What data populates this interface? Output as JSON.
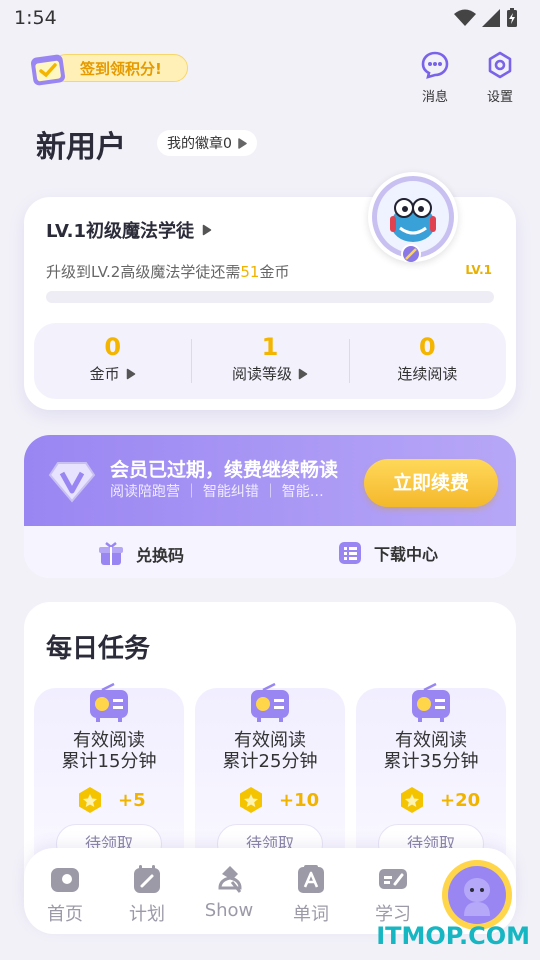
{
  "status": {
    "time": "1:54"
  },
  "header": {
    "checkin_label": "签到领积分!",
    "messages_label": "消息",
    "settings_label": "设置"
  },
  "profile": {
    "title": "新用户",
    "badge_label": "我的徽章0"
  },
  "level": {
    "title": "LV.1初级魔法学徒",
    "upgrade_prefix": "升级到LV.2高级魔法学徒还需",
    "upgrade_amount": "51",
    "upgrade_suffix": "金币",
    "tag": "LV.1",
    "progress": 0
  },
  "stats": [
    {
      "value": "0",
      "label": "金币"
    },
    {
      "value": "1",
      "label": "阅读等级"
    },
    {
      "value": "0",
      "label": "连续阅读"
    }
  ],
  "vip": {
    "title": "会员已过期，续费继续畅读",
    "subtitle": "阅读陪跑营 ｜ 智能纠错 ｜ 智能…",
    "renew_label": "立即续费",
    "redeem_label": "兑换码",
    "download_label": "下载中心"
  },
  "tasks": {
    "title": "每日任务",
    "items": [
      {
        "line1": "有效阅读",
        "line2": "累计15分钟",
        "reward": "+5",
        "button": "待领取"
      },
      {
        "line1": "有效阅读",
        "line2": "累计25分钟",
        "reward": "+10",
        "button": "待领取"
      },
      {
        "line1": "有效阅读",
        "line2": "累计35分钟",
        "reward": "+20",
        "button": "待领取"
      }
    ]
  },
  "tabs": [
    {
      "label": "首页",
      "icon": "home-icon"
    },
    {
      "label": "计划",
      "icon": "plan-icon"
    },
    {
      "label": "Show",
      "icon": "show-icon"
    },
    {
      "label": "单词",
      "icon": "word-icon"
    },
    {
      "label": "学习",
      "icon": "study-icon"
    }
  ],
  "watermark": "ITMOP.COM",
  "colors": {
    "accent": "#9a86f2",
    "gold": "#f3b500",
    "brand_teal": "#16b6c2"
  }
}
